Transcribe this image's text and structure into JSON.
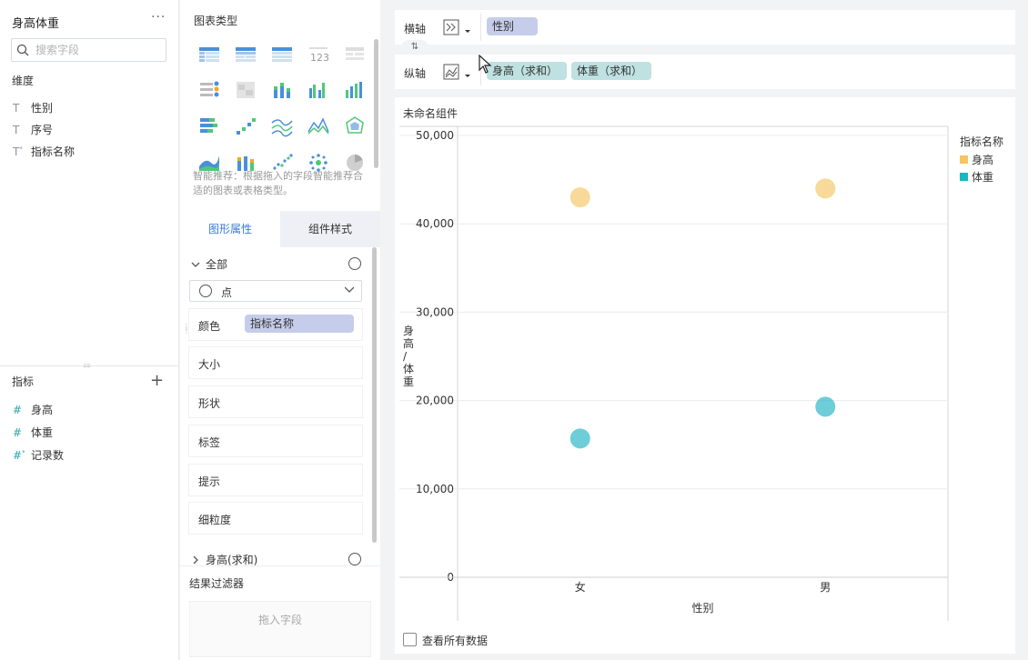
{
  "fields_panel": {
    "title": "身高体重",
    "more": "···",
    "search_placeholder": "搜索字段",
    "dimensions_label": "维度",
    "dimensions": [
      {
        "type": "T",
        "label": "性别"
      },
      {
        "type": "T",
        "label": "序号"
      },
      {
        "type": "T*",
        "label": "指标名称"
      }
    ],
    "measures_label": "指标",
    "measures": [
      {
        "type": "#",
        "label": "身高"
      },
      {
        "type": "#",
        "label": "体重"
      },
      {
        "type": "#*",
        "label": "记录数"
      }
    ]
  },
  "chart_types": {
    "title": "图表类型",
    "hint": "智能推荐：根据拖入的字段智能推荐合适的图表或表格类型。"
  },
  "attributes": {
    "tab_graph": "图形属性",
    "tab_style": "组件样式",
    "all_label": "全部",
    "mark_type": "点",
    "color_label": "颜色",
    "color_field": "指标名称",
    "size_label": "大小",
    "shape_label": "形状",
    "label_label": "标签",
    "tooltip_label": "提示",
    "granularity_label": "细粒度",
    "sub_section": "身高(求和)"
  },
  "filter": {
    "title": "结果过滤器",
    "drop_hint": "拖入字段"
  },
  "shelves": {
    "x_label": "横轴",
    "x_fields": [
      "性别"
    ],
    "y_label": "纵轴",
    "y_fields": [
      "身高（求和）",
      "体重（求和）"
    ]
  },
  "chart": {
    "component_title": "未命名组件",
    "legend_title": "指标名称",
    "show_all_label": "查看所有数据"
  },
  "colors": {
    "height": "#f5c463",
    "weight": "#1fb3c4",
    "accent": "#3c7bd6"
  },
  "chart_data": {
    "type": "scatter",
    "categories": [
      "女",
      "男"
    ],
    "series": [
      {
        "name": "身高",
        "values": [
          43000,
          44000
        ]
      },
      {
        "name": "体重",
        "values": [
          15700,
          19300
        ]
      }
    ],
    "xlabel": "性别",
    "ylabel": "身高/体重",
    "ylim": [
      0,
      50000
    ],
    "yticks": [
      "0",
      "10,000",
      "20,000",
      "30,000",
      "40,000",
      "50,000"
    ],
    "grid": true,
    "legend": "top-right"
  }
}
